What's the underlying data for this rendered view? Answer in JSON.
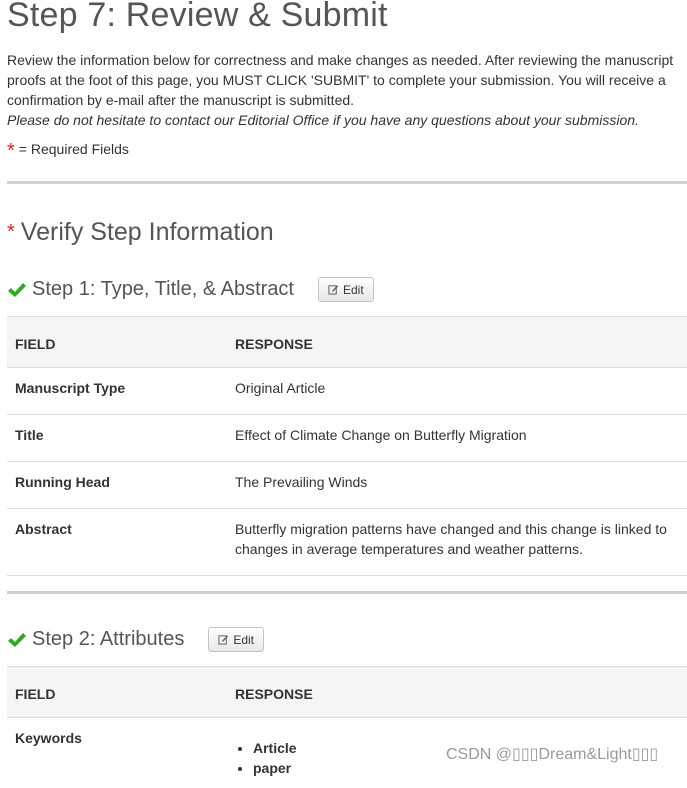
{
  "page": {
    "title": "Step 7: Review & Submit",
    "intro": "Review the information below for correctness and make changes as needed. After reviewing the manuscript proofs at the foot of this page, you MUST CLICK 'SUBMIT' to complete your submission. You will receive a confirmation by e-mail after the manuscript is submitted.",
    "intro_italic": "Please do not hesitate to contact our Editorial Office if you have any questions about your submission.",
    "required_star": "*",
    "required_label": "= Required Fields"
  },
  "verify": {
    "star": "*",
    "title": "Verify Step Information"
  },
  "step1": {
    "title": "Step 1: Type, Title, & Abstract",
    "edit_label": "Edit",
    "col_field": "FIELD",
    "col_response": "RESPONSE",
    "rows": [
      {
        "field": "Manuscript Type",
        "response": "Original Article"
      },
      {
        "field": "Title",
        "response": "Effect of Climate Change on Butterfly Migration"
      },
      {
        "field": "Running Head",
        "response": "The Prevailing Winds"
      },
      {
        "field": "Abstract",
        "response": "Butterfly migration patterns have changed and this change is linked to changes in average temperatures and weather patterns."
      }
    ]
  },
  "step2": {
    "title": "Step 2: Attributes",
    "edit_label": "Edit",
    "col_field": "FIELD",
    "col_response": "RESPONSE",
    "keywords_label": "Keywords",
    "keywords": [
      "Article",
      "paper"
    ]
  },
  "colors": {
    "check": "#2eaa1f",
    "required": "#d9251c",
    "header_bg": "#f5f5f5"
  },
  "icons": {
    "check": "check-icon",
    "edit": "edit-pencil-icon"
  },
  "watermark": "CSDN @▯▯▯Dream&Light▯▯▯"
}
